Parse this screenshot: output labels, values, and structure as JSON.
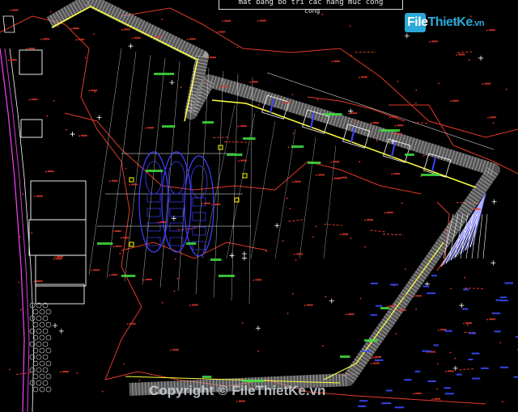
{
  "header": {
    "title": "mat bang bo tri cac hang muc cong",
    "subtitle": "cong"
  },
  "logo": {
    "part1": "File",
    "part2": "ThietKe",
    "tld": ".vn"
  },
  "watermark": "Copyright © FileThietKe.vn",
  "colors": {
    "background": "#000000",
    "contour": "#e03a2a",
    "revetment": "#9a9a9a",
    "centerline": "#ffff40",
    "annotation": "#40e040",
    "dimension": "#ffffff",
    "vessel": "#4040ff",
    "slope": "#6060ff",
    "mooring": "#ffff00",
    "boundary": "#ff40ff"
  }
}
